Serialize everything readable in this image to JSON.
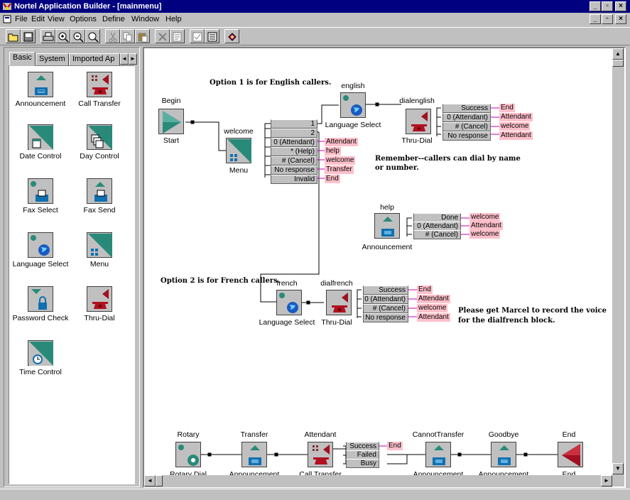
{
  "window": {
    "title": "Nortel Application Builder - [mainmenu]",
    "min": "_",
    "max": "▫",
    "close": "×"
  },
  "menu": [
    "File",
    "Edit",
    "View",
    "Options",
    "Define",
    "Window",
    "Help"
  ],
  "toolbar": {
    "tools": [
      "open-icon",
      "save-icon",
      "print-icon",
      "zoom-in-icon",
      "zoom-out-icon",
      "zoom-fit-icon",
      "cut-icon",
      "copy-icon",
      "paste-icon",
      "delete-icon",
      "properties-icon",
      "verify-icon",
      "list-icon",
      "help-book-icon"
    ]
  },
  "palette": {
    "tabs": [
      "Basic",
      "System",
      "Imported Ap"
    ],
    "items": [
      "Announcement",
      "Call Transfer",
      "Date Control",
      "Day Control",
      "Fax Select",
      "Fax Send",
      "Language Select",
      "Menu",
      "Password Check",
      "Thru-Dial",
      "Time Control"
    ]
  },
  "nodes": {
    "begin": {
      "name": "Begin",
      "type": "Start"
    },
    "welcome": {
      "name": "welcome",
      "type": "Menu"
    },
    "english": {
      "name": "english",
      "type": "Language Select"
    },
    "dialenglish": {
      "name": "dialenglish",
      "type": "Thru-Dial"
    },
    "help": {
      "name": "help",
      "type": "Announcement"
    },
    "french": {
      "name": "french",
      "type": "Language Select"
    },
    "dialfrench": {
      "name": "dialfrench",
      "type": "Thru-Dial"
    },
    "rotary": {
      "name": "Rotary",
      "type": "Rotary Dial"
    },
    "transfer": {
      "name": "Transfer",
      "type": "Announcement"
    },
    "attendant": {
      "name": "Attendant",
      "type": "Call Transfer"
    },
    "cannottransfer": {
      "name": "CannotTransfer",
      "type": "Announcement"
    },
    "goodbye": {
      "name": "Goodbye",
      "type": "Announcement"
    },
    "end": {
      "name": "End",
      "type": "End"
    }
  },
  "welcome_options": [
    {
      "label": "1",
      "target": ""
    },
    {
      "label": "2",
      "target": ""
    },
    {
      "label": "0 (Attendant)",
      "target": "Attendant"
    },
    {
      "label": "* (Help)",
      "target": "help"
    },
    {
      "label": "# (Cancel)",
      "target": "welcome"
    },
    {
      "label": "No response",
      "target": "Transfer"
    },
    {
      "label": "Invalid",
      "target": "End"
    }
  ],
  "dialenglish_options": [
    {
      "label": "Success",
      "target": "End"
    },
    {
      "label": "0 (Attendant)",
      "target": "Attendant"
    },
    {
      "label": "# (Cancel)",
      "target": "welcome"
    },
    {
      "label": "No response",
      "target": "Attendant"
    }
  ],
  "help_options": [
    {
      "label": "Done",
      "target": "welcome"
    },
    {
      "label": "0 (Attendant)",
      "target": "Attendant"
    },
    {
      "label": "# (Cancel)",
      "target": "welcome"
    }
  ],
  "dialfrench_options": [
    {
      "label": "Success",
      "target": "End"
    },
    {
      "label": "0 (Attendant)",
      "target": "Attendant"
    },
    {
      "label": "# (Cancel)",
      "target": "welcome"
    },
    {
      "label": "No response",
      "target": "Attendant"
    }
  ],
  "attendant_options": [
    {
      "label": "Success",
      "target": "End"
    },
    {
      "label": "Failed",
      "target": ""
    },
    {
      "label": "Busy",
      "target": ""
    }
  ],
  "notes": {
    "n1": "Option 1 is for English callers.",
    "n2": "Remember--callers can dial by name",
    "n2b": "or number.",
    "n3": "Option 2 is for French callers.",
    "n4": "Please get Marcel to record the voice",
    "n4b": "for the dialfrench block."
  }
}
